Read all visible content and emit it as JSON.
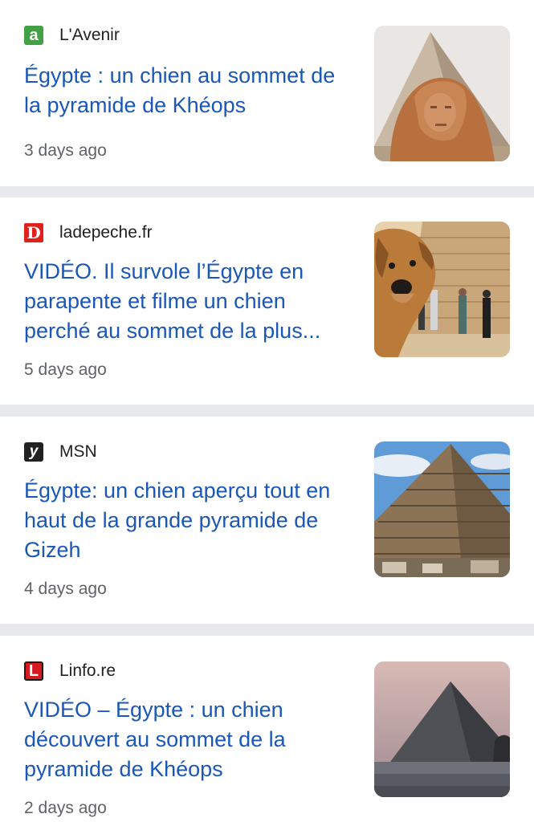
{
  "articles": [
    {
      "source": "L'Avenir",
      "logo_letter": "a",
      "logo_color": "#43a047",
      "headline": "Égypte : un chien au sommet de la pyramide de Khéops",
      "time": "3 days ago",
      "thumbnail": "sphinx-pyramid-image"
    },
    {
      "source": "ladepeche.fr",
      "logo_letter": "D",
      "logo_color": "#e0201a",
      "headline": "VIDÉO. Il survole l’Égypte en parapente et filme un chien perché au sommet de la plus...",
      "time": "5 days ago",
      "thumbnail": "dog-at-pyramid-image"
    },
    {
      "source": "MSN",
      "logo_letter": "y",
      "logo_color": "#222222",
      "headline": "Égypte: un chien aperçu tout en haut de la grande pyramide de Gizeh",
      "time": "4 days ago",
      "thumbnail": "great-pyramid-image"
    },
    {
      "source": "Linfo.re",
      "logo_letter": "L",
      "logo_color": "#d71920",
      "headline": "VIDÉO – Égypte : un chien découvert au sommet de la pyramide de Khéops",
      "time": "2 days ago",
      "thumbnail": "pyramid-dusk-image"
    }
  ]
}
